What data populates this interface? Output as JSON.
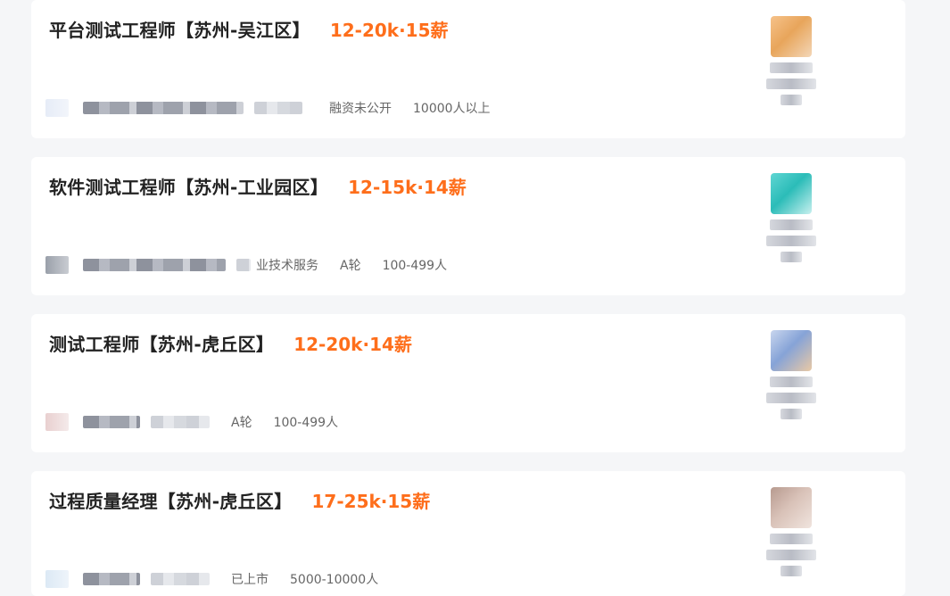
{
  "jobs": [
    {
      "title": "平台测试工程师【苏州-吴江区】",
      "salary": "12-20k·15薪",
      "meta": [
        "融资未公开",
        "10000人以上"
      ]
    },
    {
      "title": "软件测试工程师【苏州-工业园区】",
      "salary": "12-15k·14薪",
      "meta": [
        "业技术服务",
        "A轮",
        "100-499人"
      ]
    },
    {
      "title": "测试工程师【苏州-虎丘区】",
      "salary": "12-20k·14薪",
      "meta": [
        "A轮",
        "100-499人"
      ]
    },
    {
      "title": "过程质量经理【苏州-虎丘区】",
      "salary": "17-25k·15薪",
      "meta": [
        "已上市",
        "5000-10000人"
      ]
    }
  ],
  "colors": {
    "salary": "#fe6e1b",
    "title": "#222222",
    "meta": "#666666",
    "background": "#f5f6f8",
    "card": "#ffffff"
  },
  "icons": {
    "company_logo": "company-logo-icon",
    "recruiter_avatar": "recruiter-avatar-icon"
  }
}
